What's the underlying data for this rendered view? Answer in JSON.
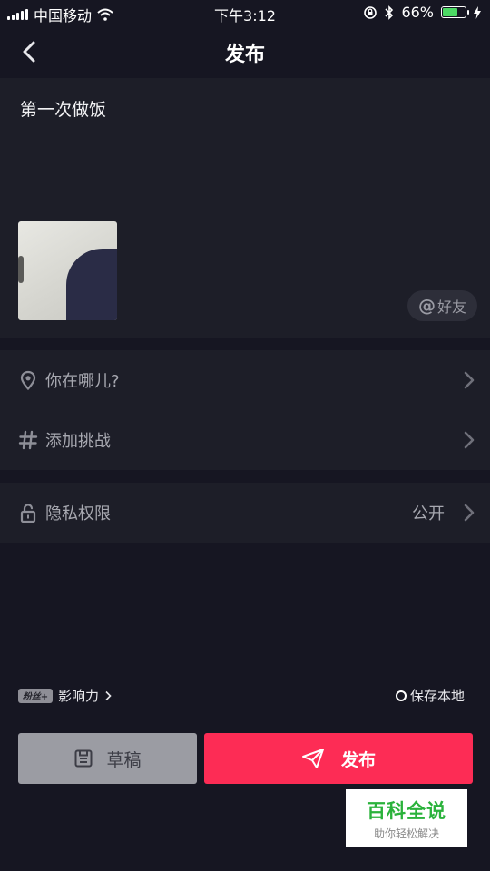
{
  "status_bar": {
    "carrier": "中国移动",
    "time": "下午3:12",
    "battery_percent": "66%",
    "battery_level": 0.66,
    "icons": [
      "signal-icon",
      "wifi-icon",
      "orientation-lock-icon",
      "bluetooth-icon",
      "battery-icon",
      "charging-icon"
    ]
  },
  "header": {
    "title": "发布",
    "back_icon": "chevron-left-icon"
  },
  "post": {
    "caption": "第一次做饭",
    "mention_label": "好友",
    "mention_symbol": "@"
  },
  "options": {
    "location": {
      "label": "你在哪儿?",
      "icon": "location-pin-icon"
    },
    "challenge": {
      "label": "添加挑战",
      "icon": "hashtag-icon"
    },
    "privacy": {
      "label": "隐私权限",
      "value": "公开",
      "icon": "unlock-icon"
    }
  },
  "footer": {
    "fans_badge": "粉丝+",
    "influence_label": "影响力",
    "save_local_label": "保存本地",
    "draft_label": "草稿",
    "publish_label": "发布"
  },
  "watermark": {
    "main": "百科全说",
    "sub": "助你轻松解决"
  },
  "colors": {
    "background": "#161622",
    "panel": "#1d1e28",
    "publish": "#fd2c55",
    "draft": "#9b9ca3",
    "battery": "#4cd964",
    "watermark_green": "#2ab23b"
  }
}
